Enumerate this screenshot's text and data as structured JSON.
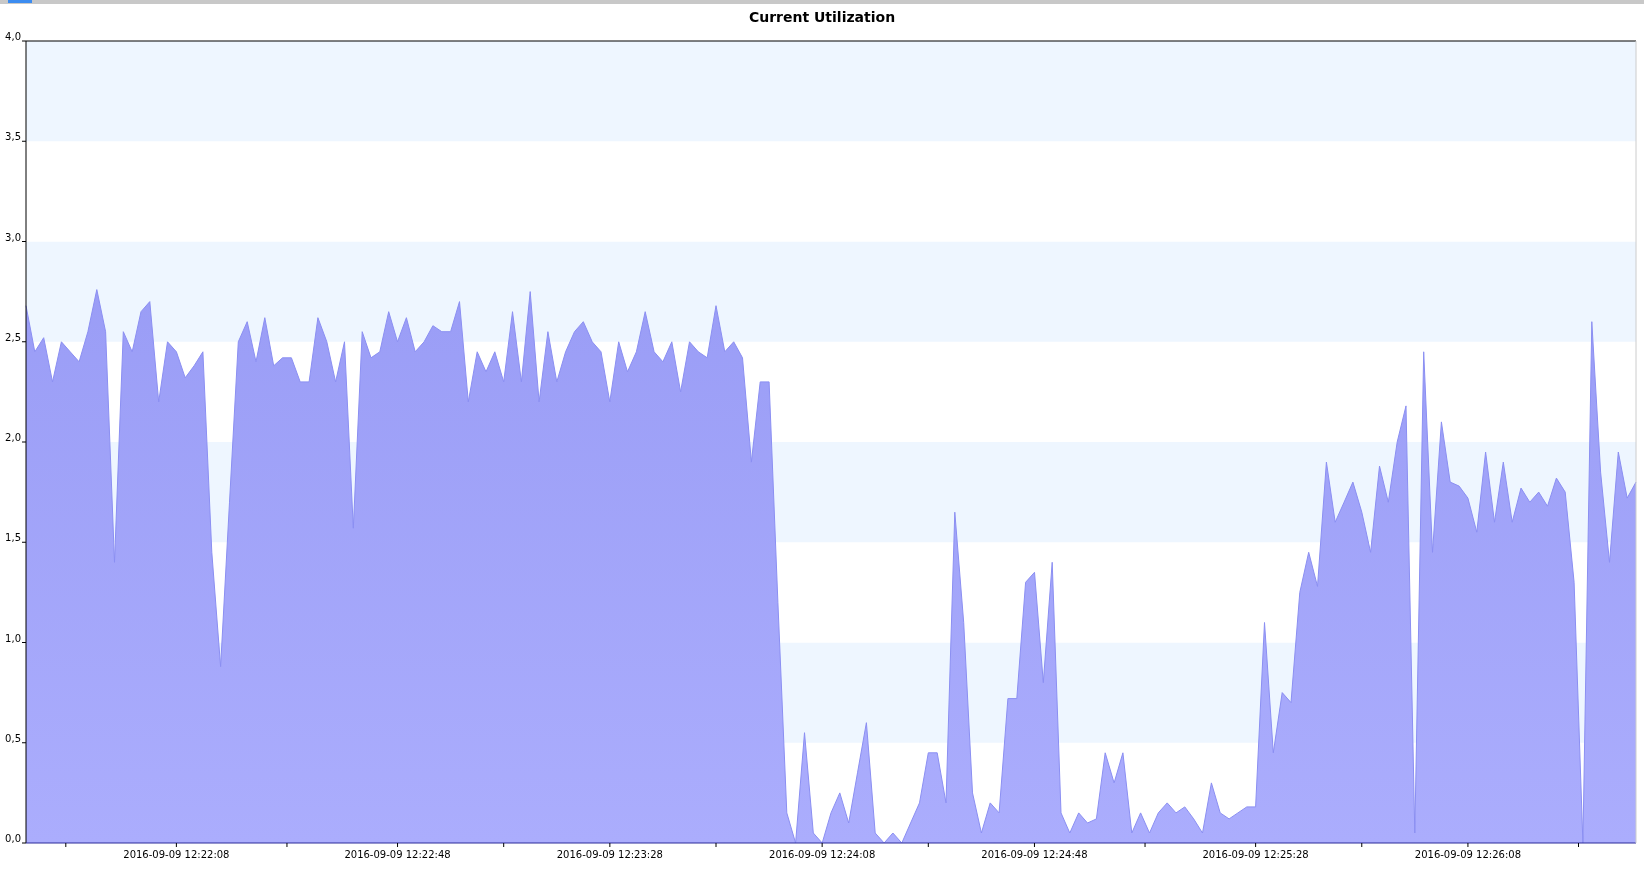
{
  "chart": {
    "chart_data": {
      "type": "area",
      "title": "Current Utilization",
      "ylim": [
        0,
        4
      ],
      "yticks": [
        {
          "value": 0,
          "label": "0,0"
        },
        {
          "value": 0.5,
          "label": "0,5"
        },
        {
          "value": 1,
          "label": "1,0"
        },
        {
          "value": 1.5,
          "label": "1,5"
        },
        {
          "value": 2,
          "label": "2,0"
        },
        {
          "value": 2.5,
          "label": "2,5"
        },
        {
          "value": 3,
          "label": "3,0"
        },
        {
          "value": 3.5,
          "label": "3,5"
        },
        {
          "value": 4,
          "label": "4,0"
        }
      ],
      "categories": [
        null,
        null,
        null,
        null,
        null,
        null,
        null,
        null,
        null,
        null,
        null,
        null,
        null,
        null,
        null,
        null,
        null,
        "2016-09-09 12:22:08",
        null,
        null,
        null,
        null,
        null,
        null,
        null,
        null,
        null,
        null,
        null,
        null,
        null,
        null,
        null,
        null,
        null,
        null,
        null,
        null,
        null,
        null,
        null,
        null,
        "2016-09-09 12:22:48",
        null,
        null,
        null,
        null,
        null,
        null,
        null,
        null,
        null,
        null,
        null,
        null,
        null,
        null,
        null,
        null,
        null,
        null,
        null,
        null,
        null,
        null,
        null,
        "2016-09-09 12:23:28",
        null,
        null,
        null,
        null,
        null,
        null,
        null,
        null,
        null,
        null,
        null,
        null,
        null,
        null,
        null,
        null,
        null,
        null,
        null,
        null,
        null,
        null,
        null,
        "2016-09-09 12:24:08",
        null,
        null,
        null,
        null,
        null,
        null,
        null,
        null,
        null,
        null,
        null,
        null,
        null,
        null,
        null,
        null,
        null,
        null,
        null,
        null,
        null,
        null,
        null,
        "2016-09-09 12:24:48",
        null,
        null,
        null,
        null,
        null,
        null,
        null,
        null,
        null,
        null,
        null,
        null,
        null,
        null,
        null,
        null,
        null,
        null,
        null,
        null,
        null,
        null,
        null,
        null,
        "2016-09-09 12:25:28",
        null,
        null,
        null,
        null,
        null,
        null,
        null,
        null,
        null,
        null,
        null,
        null,
        null,
        null,
        null,
        null,
        null,
        null,
        null,
        null,
        null,
        null,
        null,
        "2016-09-09 12:26:08",
        null,
        null,
        null,
        null,
        null,
        null,
        null,
        null,
        null,
        null,
        null,
        null,
        null,
        null,
        null,
        null,
        null,
        null,
        null
      ],
      "values": [
        2.68,
        2.45,
        2.52,
        2.3,
        2.5,
        2.45,
        2.4,
        2.55,
        2.76,
        2.55,
        1.4,
        2.55,
        2.45,
        2.65,
        2.7,
        2.2,
        2.5,
        2.45,
        2.32,
        2.38,
        2.45,
        1.45,
        0.88,
        1.7,
        2.5,
        2.6,
        2.4,
        2.62,
        2.38,
        2.42,
        2.42,
        2.3,
        2.3,
        2.62,
        2.5,
        2.3,
        2.5,
        1.57,
        2.55,
        2.42,
        2.45,
        2.65,
        2.5,
        2.62,
        2.45,
        2.5,
        2.58,
        2.55,
        2.55,
        2.7,
        2.2,
        2.45,
        2.35,
        2.45,
        2.3,
        2.65,
        2.3,
        2.75,
        2.2,
        2.55,
        2.3,
        2.45,
        2.55,
        2.6,
        2.5,
        2.45,
        2.2,
        2.5,
        2.35,
        2.45,
        2.65,
        2.45,
        2.4,
        2.5,
        2.25,
        2.5,
        2.45,
        2.42,
        2.68,
        2.45,
        2.5,
        2.42,
        1.9,
        2.3,
        2.3,
        1.2,
        0.15,
        0,
        0.55,
        0.05,
        0,
        0.15,
        0.25,
        0.1,
        0.35,
        0.6,
        0.05,
        0,
        0.05,
        0,
        0.1,
        0.2,
        0.45,
        0.45,
        0.2,
        1.65,
        1.1,
        0.25,
        0.05,
        0.2,
        0.15,
        0.72,
        0.72,
        1.3,
        1.35,
        0.8,
        1.4,
        0.15,
        0.05,
        0.15,
        0.1,
        0.12,
        0.45,
        0.3,
        0.45,
        0.05,
        0.15,
        0.05,
        0.15,
        0.2,
        0.15,
        0.18,
        0.12,
        0.05,
        0.3,
        0.15,
        0.12,
        0.15,
        0.18,
        0.18,
        1.1,
        0.45,
        0.75,
        0.7,
        1.25,
        1.45,
        1.28,
        1.9,
        1.6,
        1.7,
        1.8,
        1.65,
        1.45,
        1.88,
        1.7,
        2,
        2.18,
        0.05,
        2.45,
        1.45,
        2.1,
        1.8,
        1.78,
        1.72,
        1.55,
        1.95,
        1.6,
        1.9,
        1.6,
        1.77,
        1.7,
        1.75,
        1.68,
        1.82,
        1.75,
        1.3,
        0,
        2.6,
        1.85,
        1.4,
        1.95,
        1.72,
        1.8
      ]
    }
  }
}
